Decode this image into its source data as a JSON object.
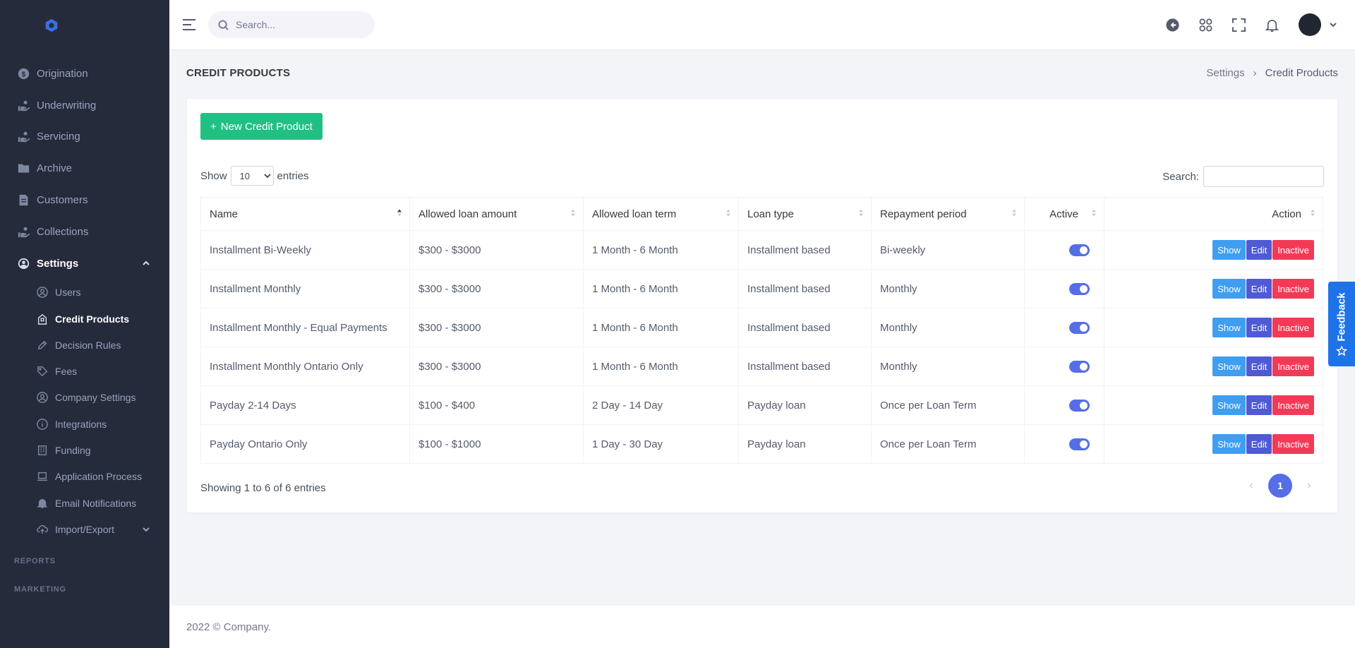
{
  "colors": {
    "accent": "#556ee6",
    "success": "#20c083",
    "danger": "#f23a57",
    "info": "#3f9ef0",
    "sidebar_bg": "#262b3c",
    "feedback": "#1e73e8"
  },
  "sidebar": {
    "logo_icon": "hexagon-logo-icon",
    "items": [
      {
        "label": "Origination",
        "icon": "dollar-circle-icon"
      },
      {
        "label": "Underwriting",
        "icon": "hand-coins-icon"
      },
      {
        "label": "Servicing",
        "icon": "hand-coins-icon"
      },
      {
        "label": "Archive",
        "icon": "folder-icon"
      },
      {
        "label": "Customers",
        "icon": "file-user-icon"
      },
      {
        "label": "Collections",
        "icon": "hand-coins-icon"
      },
      {
        "label": "Settings",
        "icon": "user-circle-icon"
      }
    ],
    "settings_sub": [
      {
        "label": "Users",
        "icon": "user-circle-icon"
      },
      {
        "label": "Credit Products",
        "icon": "building-icon"
      },
      {
        "label": "Decision Rules",
        "icon": "pencil-icon"
      },
      {
        "label": "Fees",
        "icon": "tag-icon"
      },
      {
        "label": "Company Settings",
        "icon": "user-circle-icon"
      },
      {
        "label": "Integrations",
        "icon": "info-icon"
      },
      {
        "label": "Funding",
        "icon": "building-grid-icon"
      },
      {
        "label": "Application Process",
        "icon": "laptop-icon"
      },
      {
        "label": "Email Notifications",
        "icon": "bell-icon"
      },
      {
        "label": "Import/Export",
        "icon": "cloud-upload-icon"
      }
    ],
    "sections": [
      "REPORTS",
      "MARKETING"
    ]
  },
  "topbar": {
    "search_placeholder": "Search...",
    "icons": [
      "back-circle-icon",
      "apps-grid-icon",
      "fullscreen-icon",
      "bell-icon"
    ]
  },
  "page": {
    "title": "CREDIT PRODUCTS",
    "breadcrumb": [
      "Settings",
      "Credit Products"
    ]
  },
  "card": {
    "new_button": "New Credit Product",
    "show_label": "Show",
    "entries_label": "entries",
    "page_length": "10",
    "search_label": "Search:",
    "columns": [
      "Name",
      "Allowed loan amount",
      "Allowed loan term",
      "Loan type",
      "Repayment period",
      "Active",
      "Action"
    ],
    "rows": [
      {
        "name": "Installment Bi-Weekly",
        "amount": "$300 - $3000",
        "term": "1 Month - 6 Month",
        "type": "Installment based",
        "period": "Bi-weekly",
        "active": true
      },
      {
        "name": "Installment Monthly",
        "amount": "$300 - $3000",
        "term": "1 Month - 6 Month",
        "type": "Installment based",
        "period": "Monthly",
        "active": true
      },
      {
        "name": "Installment Monthly - Equal Payments",
        "amount": "$300 - $3000",
        "term": "1 Month - 6 Month",
        "type": "Installment based",
        "period": "Monthly",
        "active": true
      },
      {
        "name": "Installment Monthly Ontario Only",
        "amount": "$300 - $3000",
        "term": "1 Month - 6 Month",
        "type": "Installment based",
        "period": "Monthly",
        "active": true
      },
      {
        "name": "Payday 2-14 Days",
        "amount": "$100 - $400",
        "term": "2 Day - 14 Day",
        "type": "Payday loan",
        "period": "Once per Loan Term",
        "active": true
      },
      {
        "name": "Payday Ontario Only",
        "amount": "$100 - $1000",
        "term": "1 Day - 30 Day",
        "type": "Payday loan",
        "period": "Once per Loan Term",
        "active": true
      }
    ],
    "actions": {
      "show": "Show",
      "edit": "Edit",
      "inactive": "Inactive"
    },
    "showing": "Showing 1 to 6 of 6 entries",
    "pager": {
      "prev": "‹",
      "current": "1",
      "next": "›"
    }
  },
  "footer": {
    "text": "2022 © Company."
  },
  "feedback": {
    "label": "Feedback"
  }
}
